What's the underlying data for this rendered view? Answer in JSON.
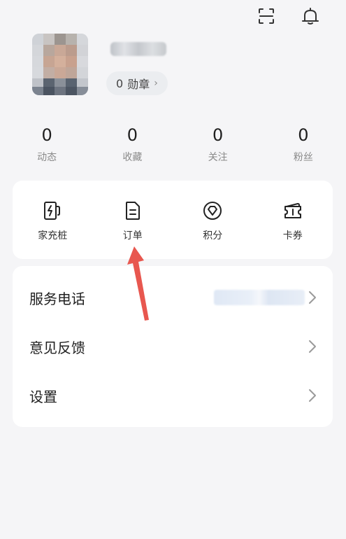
{
  "topbar": {
    "icons": [
      "scan-icon",
      "bell-icon"
    ]
  },
  "profile": {
    "badge_count": "0",
    "badge_label": "勋章",
    "badge_chevron": "›"
  },
  "stats": [
    {
      "value": "0",
      "label": "动态"
    },
    {
      "value": "0",
      "label": "收藏"
    },
    {
      "value": "0",
      "label": "关注"
    },
    {
      "value": "0",
      "label": "粉丝"
    }
  ],
  "services": [
    {
      "label": "家充桩",
      "icon": "charger-icon"
    },
    {
      "label": "订单",
      "icon": "order-icon"
    },
    {
      "label": "积分",
      "icon": "points-icon"
    },
    {
      "label": "卡券",
      "icon": "coupon-icon"
    }
  ],
  "menu": [
    {
      "label": "服务电话"
    },
    {
      "label": "意见反馈"
    },
    {
      "label": "设置"
    }
  ],
  "colors": {
    "background": "#f5f5f7",
    "card": "#ffffff",
    "annotation_arrow": "#e8574f"
  }
}
